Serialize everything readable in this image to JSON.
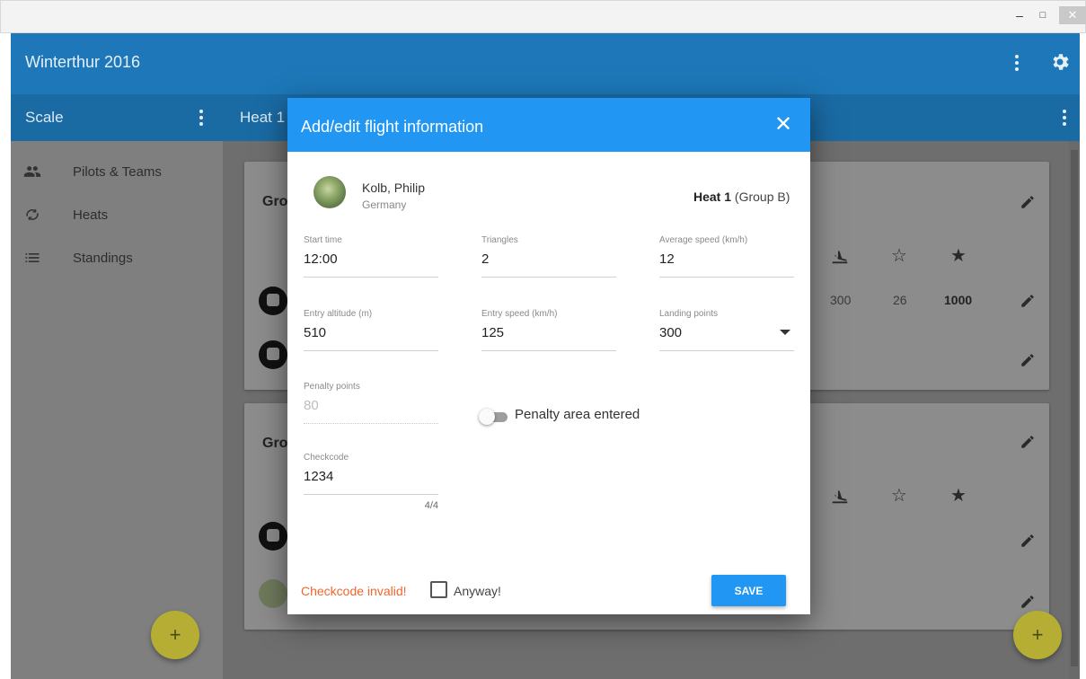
{
  "window": {
    "minimize": "–",
    "maximize": "□",
    "close": "✕"
  },
  "app": {
    "title": "Winterthur 2016"
  },
  "subbar": {
    "left_title": "Scale",
    "right_title": "Heat 1"
  },
  "sidebar": {
    "items": [
      {
        "label": "Pilots & Teams",
        "icon": "people-icon"
      },
      {
        "label": "Heats",
        "icon": "loop-icon"
      },
      {
        "label": "Standings",
        "icon": "list-icon"
      }
    ]
  },
  "content": {
    "card1": {
      "title": "Gro",
      "row_values": [
        "300",
        "26",
        "1000"
      ]
    },
    "card2": {
      "title": "Gro"
    }
  },
  "dialog": {
    "title": "Add/edit flight information",
    "close": "✕",
    "pilot": {
      "name": "Kolb, Philip",
      "country": "Germany"
    },
    "heat": {
      "label": "Heat 1",
      "group": "(Group B)"
    },
    "fields": {
      "start_time": {
        "label": "Start time",
        "value": "12:00"
      },
      "triangles": {
        "label": "Triangles",
        "value": "2"
      },
      "avg_speed": {
        "label": "Average speed (km/h)",
        "value": "12"
      },
      "entry_altitude": {
        "label": "Entry altitude (m)",
        "value": "510"
      },
      "entry_speed": {
        "label": "Entry speed (km/h)",
        "value": "125"
      },
      "landing_points": {
        "label": "Landing points",
        "value": "300"
      },
      "penalty_points": {
        "label": "Penalty points",
        "value": "80"
      },
      "checkcode": {
        "label": "Checkcode",
        "value": "1234",
        "counter": "4/4"
      }
    },
    "penalty_toggle": {
      "label": "Penalty area entered"
    },
    "error": "Checkcode invalid!",
    "anyway": "Anyway!",
    "save": "SAVE"
  },
  "fab": {
    "label": "+"
  },
  "colors": {
    "primary": "#2196f3",
    "appbar": "#1d77b8",
    "error": "#f0652e",
    "fab": "#cdc23a"
  }
}
